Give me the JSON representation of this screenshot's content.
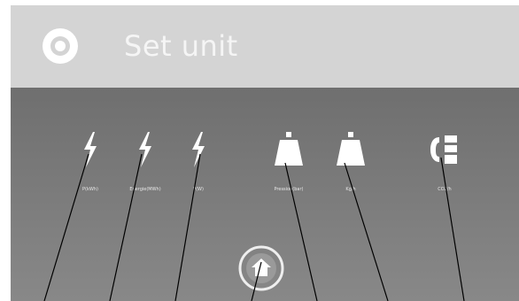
{
  "header": {
    "title": "Set unit",
    "icon": "gear-icon"
  },
  "units": [
    {
      "key": "power-kwh",
      "label": "P(kWh)",
      "icon": "lightning-icon"
    },
    {
      "key": "energy-mwh",
      "label": "Energie(MWh)",
      "icon": "lightning-icon"
    },
    {
      "key": "power-w",
      "label": "P(W)",
      "icon": "lightning-icon"
    },
    {
      "key": "pressure-bar",
      "label": "Pression(bar)",
      "icon": "weight-icon"
    },
    {
      "key": "weight-kg",
      "label": "Kg/h",
      "icon": "weight-icon"
    },
    {
      "key": "co2",
      "label": "CO2/h",
      "icon": "co2-icon"
    }
  ],
  "home": {
    "icon": "home-icon"
  },
  "colors": {
    "header_bg": "#d4d4d4",
    "panel_bg": "#7e7e7e",
    "icon_white": "#ffffff"
  }
}
